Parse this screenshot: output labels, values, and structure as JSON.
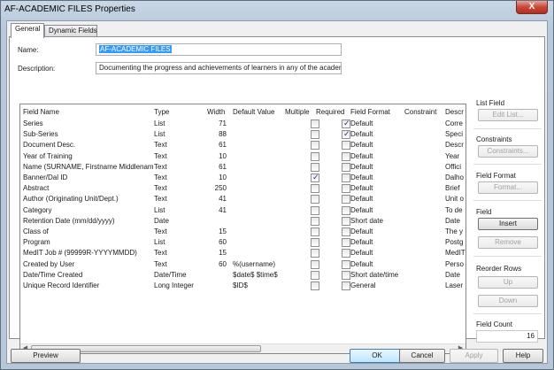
{
  "window": {
    "title": "AF-ACADEMIC FILES Properties",
    "close_glyph": "X"
  },
  "tabs": [
    {
      "label": "General",
      "active": true
    },
    {
      "label": "Dynamic Fields",
      "active": false
    }
  ],
  "form": {
    "name_label": "Name:",
    "name_value": "AF-ACADEMIC FILES",
    "description_label": "Description:",
    "description_value": "Documenting the progress and achievements of learners in any of the academic p"
  },
  "grid": {
    "columns": [
      "Field Name",
      "Type",
      "Width",
      "Default Value",
      "Multiple",
      "Required",
      "Field Format",
      "Constraint",
      "Descr"
    ],
    "rows": [
      {
        "name": "Series",
        "type": "List",
        "width": "71",
        "default": "",
        "multiple": false,
        "required": true,
        "format": "Default",
        "constraint": "",
        "desc": "Corre"
      },
      {
        "name": "Sub-Series",
        "type": "List",
        "width": "88",
        "default": "",
        "multiple": false,
        "required": true,
        "format": "Default",
        "constraint": "",
        "desc": "Speci"
      },
      {
        "name": "Document Desc.",
        "type": "Text",
        "width": "61",
        "default": "",
        "multiple": false,
        "required": false,
        "format": "Default",
        "constraint": "",
        "desc": "Descr"
      },
      {
        "name": "Year of Training",
        "type": "Text",
        "width": "10",
        "default": "",
        "multiple": false,
        "required": false,
        "format": "Default",
        "constraint": "",
        "desc": "Year"
      },
      {
        "name": "Name (SURNAME, Firstname Middlename)",
        "type": "Text",
        "width": "61",
        "default": "",
        "multiple": false,
        "required": false,
        "format": "Default",
        "constraint": "",
        "desc": "Offici"
      },
      {
        "name": "Banner/Dal ID",
        "type": "Text",
        "width": "10",
        "default": "",
        "multiple": true,
        "required": false,
        "format": "Default",
        "constraint": "",
        "desc": "Dalho"
      },
      {
        "name": "Abstract",
        "type": "Text",
        "width": "250",
        "default": "",
        "multiple": false,
        "required": false,
        "format": "Default",
        "constraint": "",
        "desc": "Brief"
      },
      {
        "name": "Author (Originating Unit/Dept.)",
        "type": "Text",
        "width": "41",
        "default": "",
        "multiple": false,
        "required": false,
        "format": "Default",
        "constraint": "",
        "desc": "Unit o"
      },
      {
        "name": "Category",
        "type": "List",
        "width": "41",
        "default": "",
        "multiple": false,
        "required": false,
        "format": "Default",
        "constraint": "",
        "desc": "To de"
      },
      {
        "name": "Retention Date (mm/dd/yyyy)",
        "type": "Date",
        "width": "",
        "default": "",
        "multiple": false,
        "required": false,
        "format": "Short date",
        "constraint": "",
        "desc": "Date"
      },
      {
        "name": "Class of",
        "type": "Text",
        "width": "15",
        "default": "",
        "multiple": false,
        "required": false,
        "format": "Default",
        "constraint": "",
        "desc": "The y"
      },
      {
        "name": "Program",
        "type": "List",
        "width": "60",
        "default": "",
        "multiple": false,
        "required": false,
        "format": "Default",
        "constraint": "",
        "desc": "Postg"
      },
      {
        "name": "MedIT Job # (99999R-YYYYMMDD)",
        "type": "Text",
        "width": "15",
        "default": "",
        "multiple": false,
        "required": false,
        "format": "Default",
        "constraint": "",
        "desc": "MedIT"
      },
      {
        "name": "Created by User",
        "type": "Text",
        "width": "60",
        "default": "%(username)",
        "multiple": false,
        "required": false,
        "format": "Default",
        "constraint": "",
        "desc": "Perso"
      },
      {
        "name": "Date/Time Created",
        "type": "Date/Time",
        "width": "",
        "default": "$date$ $time$",
        "multiple": false,
        "required": false,
        "format": "Short date/time",
        "constraint": "",
        "desc": "Date"
      },
      {
        "name": "Unique Record Identifier",
        "type": "Long Integer",
        "width": "",
        "default": "$ID$",
        "multiple": false,
        "required": false,
        "format": "General",
        "constraint": "",
        "desc": "Laser"
      }
    ]
  },
  "side": {
    "list_field": {
      "title": "List Field",
      "button": "Edit List..."
    },
    "constraints": {
      "title": "Constraints",
      "button": "Constraints..."
    },
    "field_format": {
      "title": "Field Format",
      "button": "Format..."
    },
    "field": {
      "title": "Field",
      "insert": "Insert",
      "remove": "Remove"
    },
    "reorder": {
      "title": "Reorder Rows",
      "up": "Up",
      "down": "Down"
    },
    "field_count": {
      "title": "Field Count",
      "value": "16"
    }
  },
  "bottom": {
    "preview": "Preview",
    "ok": "OK",
    "cancel": "Cancel",
    "apply": "Apply",
    "help": "Help"
  },
  "colors": {
    "selection": "#3399ff",
    "close_button": "#c7483a"
  }
}
